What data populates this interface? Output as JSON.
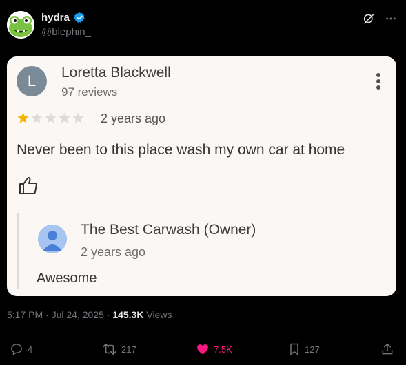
{
  "author": {
    "display_name": "hydra",
    "handle": "@blephin_"
  },
  "review": {
    "avatar_letter": "L",
    "reviewer_name": "Loretta Blackwell",
    "review_count": "97 reviews",
    "rating": 1,
    "max_rating": 5,
    "time": "2 years ago",
    "text": "Never been to this place wash my own car at home",
    "owner_reply": {
      "owner_name": "The Best Carwash (Owner)",
      "time": "2 years ago",
      "text": "Awesome"
    }
  },
  "meta": {
    "timestamp": "5:17 PM · Jul 24, 2025 · ",
    "views_count": "145.3K",
    "views_label": " Views"
  },
  "actions": {
    "replies": "4",
    "reposts": "217",
    "likes": "7.5K",
    "bookmarks": "127"
  },
  "colors": {
    "like_active": "#f91880",
    "verified": "#1d9bf0",
    "star_filled": "#f4b400",
    "star_empty": "#dcdcdc"
  }
}
